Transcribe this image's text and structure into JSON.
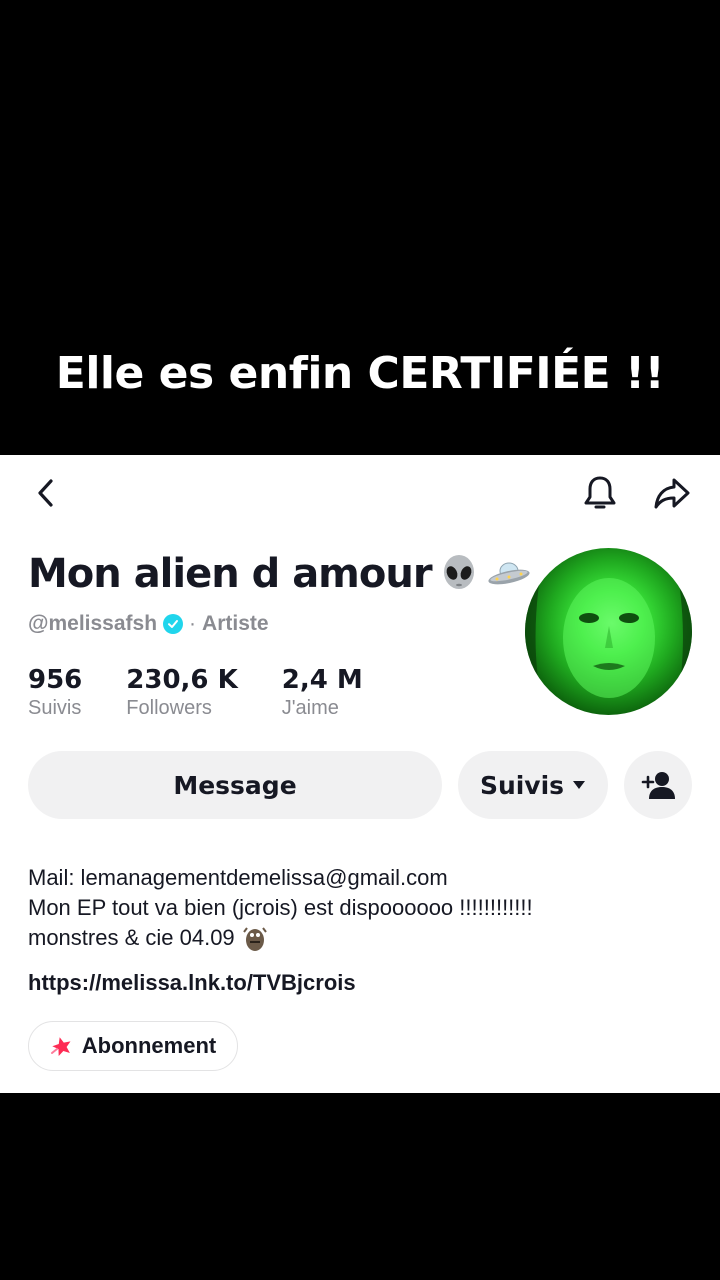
{
  "overlay": {
    "caption": "Elle es enfin CERTIFIÉE !!"
  },
  "profile": {
    "display_name": "Mon alien d amour",
    "handle": "@melissafsh",
    "separator": "·",
    "category": "Artiste",
    "stats": [
      {
        "value": "956",
        "label": "Suivis"
      },
      {
        "value": "230,6 K",
        "label": "Followers"
      },
      {
        "value": "2,4 M",
        "label": "J'aime"
      }
    ]
  },
  "actions": {
    "message_label": "Message",
    "following_label": "Suivis"
  },
  "bio": {
    "line1": "Mail: lemanagementdemelissa@gmail.com",
    "line2": "Mon EP tout va bien (jcrois) est dispoooooo !!!!!!!!!!!!",
    "line3": "monstres & cie 04.09"
  },
  "link": {
    "url": "https://melissa.lnk.to/TVBjcrois"
  },
  "subscription": {
    "label": "Abonnement"
  },
  "icons": {
    "back": "chevron-left-icon",
    "notification": "bell-icon",
    "share": "share-arrow-icon",
    "verified": "verified-badge-icon",
    "dropdown": "caret-down-icon",
    "add_friend": "add-user-icon",
    "alien": "alien-emoji-icon",
    "ufo": "ufo-emoji-icon",
    "monster": "monster-emoji-icon",
    "subscription": "star-icon"
  },
  "colors": {
    "verified": "#20d5ec",
    "subscription_star": "#fe2c55"
  }
}
